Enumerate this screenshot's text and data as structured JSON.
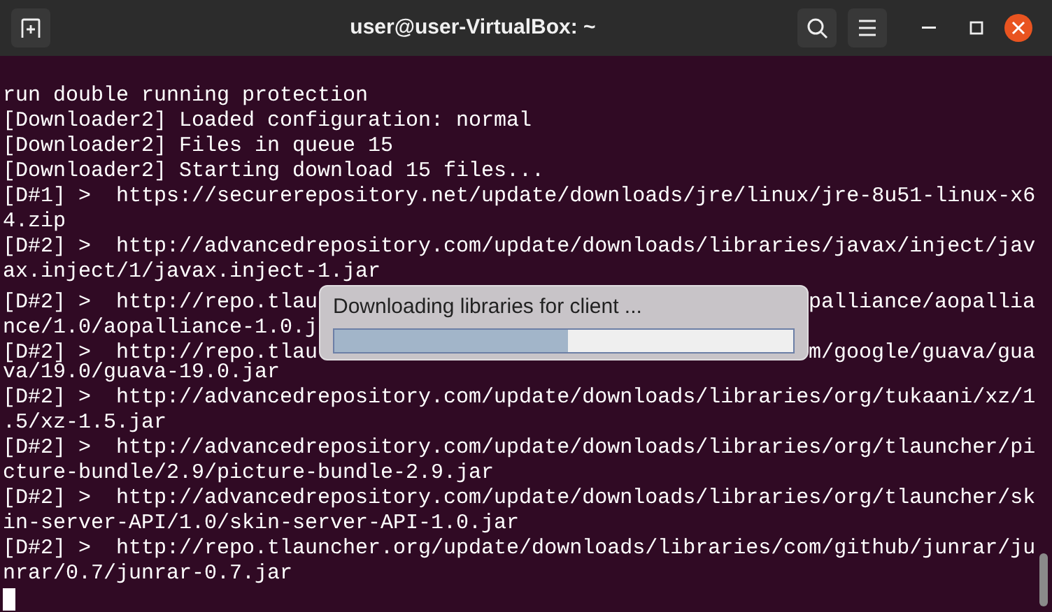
{
  "window": {
    "title": "user@user-VirtualBox: ~"
  },
  "terminal": {
    "lines": [
      "run double running protection",
      "[Downloader2] Loaded configuration: normal",
      "[Downloader2] Files in queue 15",
      "[Downloader2] Starting download 15 files...",
      "[D#1] >  https://securerepository.net/update/downloads/jre/linux/jre-8u51-linux-x6",
      "4.zip",
      "[D#2] >  http://advancedrepository.com/update/downloads/libraries/javax/inject/jav",
      "ax.inject/1/javax.inject-1.jar",
      [
        "[D#2] >  http://repo.tlau",
        "palliance/aopallia"
      ],
      [
        "nce/1.0/aopalliance-1.0.j"
      ],
      [
        "[D#2] >  http://repo.tlau",
        "m/google/guava/gua"
      ],
      "va/19.0/guava-19.0.jar",
      "[D#2] >  http://advancedrepository.com/update/downloads/libraries/org/tukaani/xz/1",
      ".5/xz-1.5.jar",
      "[D#2] >  http://advancedrepository.com/update/downloads/libraries/org/tlauncher/pi",
      "cture-bundle/2.9/picture-bundle-2.9.jar",
      "[D#2] >  http://advancedrepository.com/update/downloads/libraries/org/tlauncher/sk",
      "in-server-API/1.0/skin-server-API-1.0.jar",
      "[D#2] >  http://repo.tlauncher.org/update/downloads/libraries/com/github/junrar/ju",
      "nrar/0.7/junrar-0.7.jar"
    ]
  },
  "progress_dialog": {
    "message": "Downloading libraries for client ...",
    "level": 0.51
  }
}
